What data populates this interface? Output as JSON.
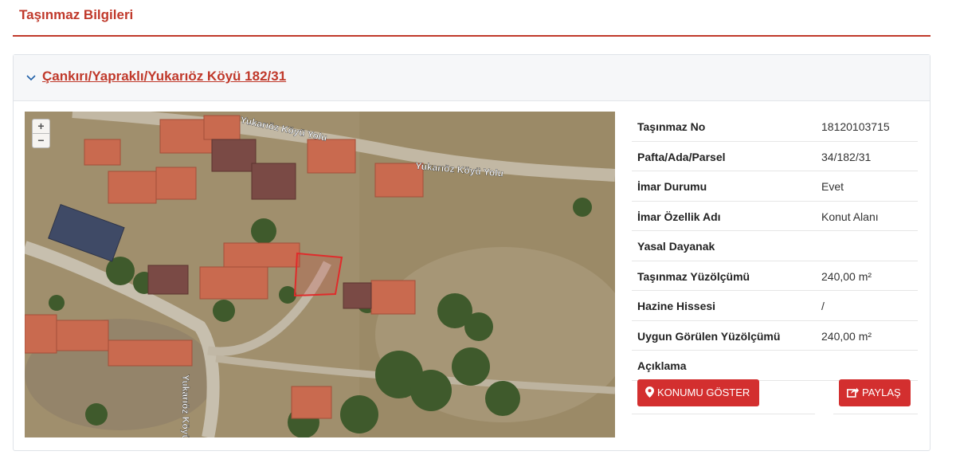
{
  "header": {
    "title": "Taşınmaz Bilgileri"
  },
  "parcel": {
    "title": "Çankırı/Yapraklı/Yukarıöz Köyü 182/31"
  },
  "map": {
    "zoom_in": "+",
    "zoom_out": "−",
    "roads": {
      "road1": "Yukarıöz Köyü Yolu",
      "road2": "Yukarıöz Köyü Yolu",
      "road3": "Yukarıöz Köyü Yolu"
    }
  },
  "info": {
    "rows": [
      {
        "label": "Taşınmaz No",
        "value": "18120103715"
      },
      {
        "label": "Pafta/Ada/Parsel",
        "value": "34/182/31"
      },
      {
        "label": "İmar Durumu",
        "value": "Evet"
      },
      {
        "label": "İmar Özellik Adı",
        "value": "Konut Alanı"
      },
      {
        "label": "Yasal Dayanak",
        "value": ""
      },
      {
        "label": "Taşınmaz Yüzölçümü",
        "value": "240,00 m²"
      },
      {
        "label": "Hazine Hissesi",
        "value": "/"
      },
      {
        "label": "Uygun Görülen Yüzölçümü",
        "value": "240,00 m²"
      },
      {
        "label": "Açıklama",
        "value": ""
      }
    ]
  },
  "actions": {
    "show_location": "KONUMU GÖSTER",
    "share": "PAYLAŞ"
  },
  "colors": {
    "accent": "#c0392b",
    "button": "#d32f2f"
  }
}
